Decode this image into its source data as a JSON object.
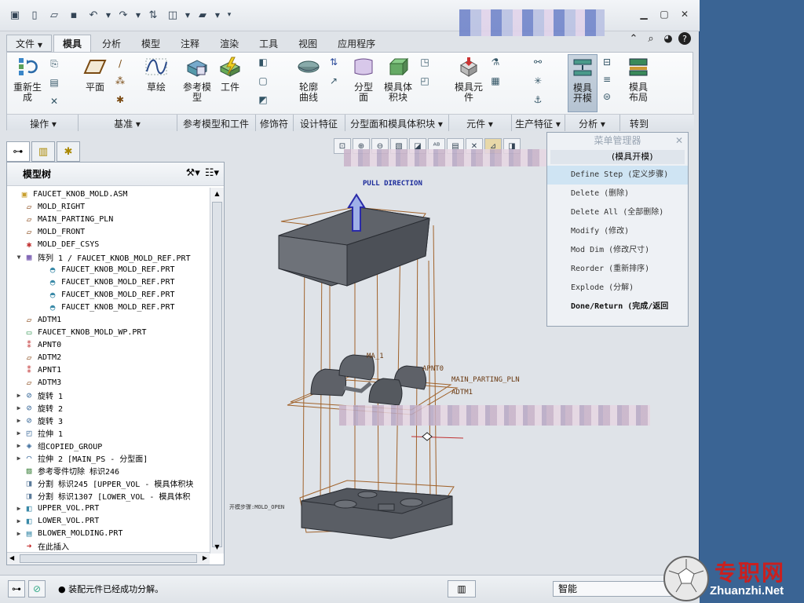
{
  "qat_icons": [
    "app-icon",
    "new-icon",
    "open-icon",
    "save-icon",
    "undo-icon",
    "redo-icon",
    "regenerate-icon",
    "windows-icon",
    "folder-icon",
    "customize-icon"
  ],
  "menubar": {
    "tabs": [
      {
        "label": "文件",
        "has_dropdown": true
      },
      {
        "label": "模具",
        "active": true
      },
      {
        "label": "分析"
      },
      {
        "label": "模型"
      },
      {
        "label": "注释"
      },
      {
        "label": "渲染"
      },
      {
        "label": "工具"
      },
      {
        "label": "视图"
      },
      {
        "label": "应用程序"
      }
    ]
  },
  "ribbon": {
    "buttons": {
      "regen": "重新生\n成",
      "plane": "平面",
      "sketch": "草绘",
      "ref_model": "参考模\n型",
      "workpiece": "工件",
      "contour": "轮廓\n曲线",
      "parting_surface": "分型\n面",
      "mold_volume": "模具体\n积块",
      "mold_component": "模具元\n件",
      "mold_open": "模具\n开模",
      "mold_layout": "模具\n布局"
    },
    "groups": [
      "操作",
      "基准",
      "参考模型和工件",
      "修饰符",
      "设计特征",
      "分型面和模具体积块",
      "元件",
      "生产特征",
      "分析",
      "转到"
    ]
  },
  "model_tree": {
    "title": "模型树",
    "items": [
      {
        "text": "FAUCET_KNOB_MOLD.ASM",
        "icon": "assembly-icon",
        "level": 0,
        "exp": ""
      },
      {
        "text": "MOLD_RIGHT",
        "icon": "datum-plane-icon",
        "level": 1,
        "exp": ""
      },
      {
        "text": "MAIN_PARTING_PLN",
        "icon": "datum-plane-icon",
        "level": 1,
        "exp": ""
      },
      {
        "text": "MOLD_FRONT",
        "icon": "datum-plane-icon",
        "level": 1,
        "exp": ""
      },
      {
        "text": "MOLD_DEF_CSYS",
        "icon": "csys-icon",
        "level": 1,
        "exp": ""
      },
      {
        "text": "阵列 1 / FAUCET_KNOB_MOLD_REF.PRT",
        "icon": "pattern-icon",
        "level": 1,
        "exp": "▼"
      },
      {
        "text": "FAUCET_KNOB_MOLD_REF.PRT",
        "icon": "part-icon",
        "level": 2,
        "exp": ""
      },
      {
        "text": "FAUCET_KNOB_MOLD_REF.PRT",
        "icon": "part-icon",
        "level": 2,
        "exp": ""
      },
      {
        "text": "FAUCET_KNOB_MOLD_REF.PRT",
        "icon": "part-icon",
        "level": 2,
        "exp": ""
      },
      {
        "text": "FAUCET_KNOB_MOLD_REF.PRT",
        "icon": "part-icon",
        "level": 2,
        "exp": ""
      },
      {
        "text": "ADTM1",
        "icon": "datum-plane-icon",
        "level": 1,
        "exp": ""
      },
      {
        "text": "FAUCET_KNOB_MOLD_WP.PRT",
        "icon": "workpiece-icon",
        "level": 1,
        "exp": ""
      },
      {
        "text": "APNT0",
        "icon": "datum-point-icon",
        "level": 1,
        "exp": ""
      },
      {
        "text": "ADTM2",
        "icon": "datum-plane-icon",
        "level": 1,
        "exp": ""
      },
      {
        "text": "APNT1",
        "icon": "datum-point-icon",
        "level": 1,
        "exp": ""
      },
      {
        "text": "ADTM3",
        "icon": "datum-plane-icon",
        "level": 1,
        "exp": ""
      },
      {
        "text": "旋转 1",
        "icon": "revolve-icon",
        "level": 1,
        "exp": "▶"
      },
      {
        "text": "旋转 2",
        "icon": "revolve-icon",
        "level": 1,
        "exp": "▶"
      },
      {
        "text": "旋转 3",
        "icon": "revolve-icon",
        "level": 1,
        "exp": "▶"
      },
      {
        "text": "拉伸 1",
        "icon": "extrude-icon",
        "level": 1,
        "exp": "▶"
      },
      {
        "text": "组COPIED_GROUP",
        "icon": "group-icon",
        "level": 1,
        "exp": "▶"
      },
      {
        "text": "拉伸 2 [MAIN_PS - 分型面]",
        "icon": "surface-icon",
        "level": 1,
        "exp": "▶"
      },
      {
        "text": "参考零件切除 标识246",
        "icon": "cut-icon",
        "level": 1,
        "exp": ""
      },
      {
        "text": "分割 标识245 [UPPER_VOL - 模具体积块",
        "icon": "split-icon",
        "level": 1,
        "exp": ""
      },
      {
        "text": "分割 标识1307 [LOWER_VOL - 模具体积",
        "icon": "split-icon",
        "level": 1,
        "exp": ""
      },
      {
        "text": "UPPER_VOL.PRT",
        "icon": "volume-icon",
        "level": 1,
        "exp": "▶"
      },
      {
        "text": "LOWER_VOL.PRT",
        "icon": "volume-icon",
        "level": 1,
        "exp": "▶"
      },
      {
        "text": "BLOWER_MOLDING.PRT",
        "icon": "molding-icon",
        "level": 1,
        "exp": "▶"
      },
      {
        "text": "在此插入",
        "icon": "insert-arrow-icon",
        "level": 1,
        "exp": ""
      }
    ]
  },
  "menu_manager": {
    "title": "菜单管理器",
    "subtitle": "(模具开模)",
    "items": [
      {
        "text": "Define Step (定义步骤)",
        "selected": true
      },
      {
        "text": "Delete (删除)"
      },
      {
        "text": "Delete All (全部删除)"
      },
      {
        "text": "Modify (修改)"
      },
      {
        "text": "Mod Dim (修改尺寸)"
      },
      {
        "text": "Reorder (重新排序)"
      },
      {
        "text": "Explode (分解)"
      },
      {
        "text": "Done/Return (完成/返回",
        "bold": true
      }
    ]
  },
  "viewport_labels": {
    "pull_direction": "PULL DIRECTION",
    "main_parting_pln": "MAIN_PARTING_PLN",
    "adtm1": "ADTM1",
    "apnt0": "APNT0",
    "ma1": "MA_1",
    "mold_open": "开模步骤:MOLD_OPEN"
  },
  "statusbar": {
    "message": "● 装配元件已经成功分解。",
    "mode": "智能"
  },
  "watermark": {
    "text": "专职网",
    "url": "Zhuanzhi.Net"
  }
}
